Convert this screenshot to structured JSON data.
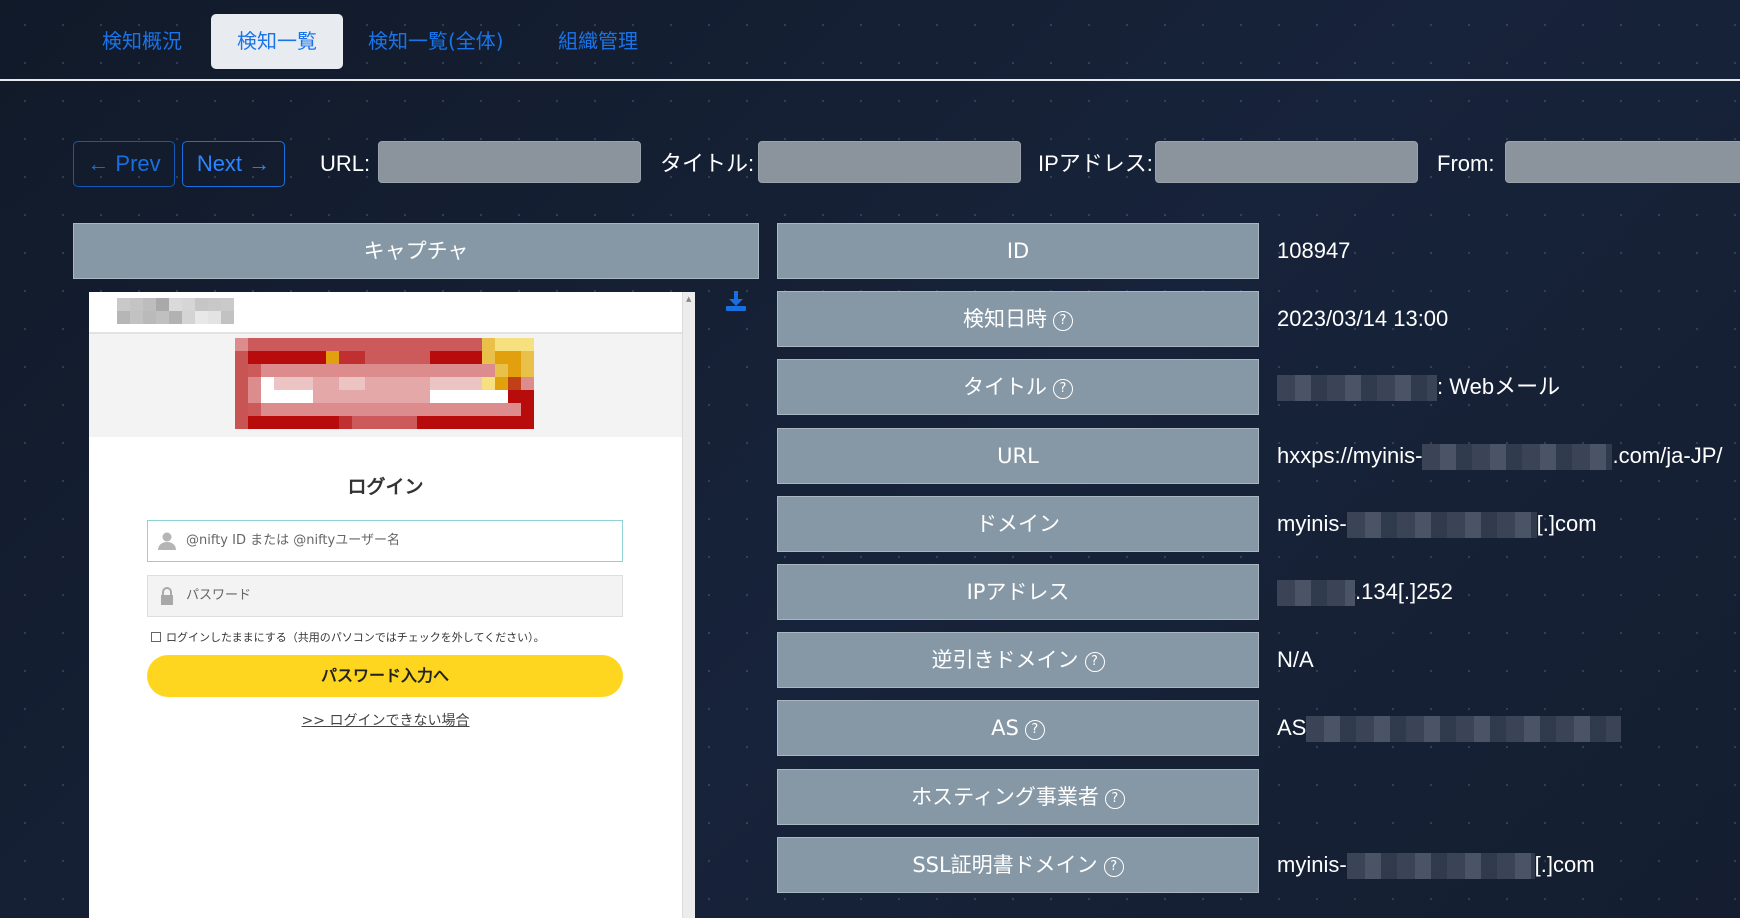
{
  "nav": {
    "tabs": [
      {
        "label": "検知概況",
        "active": false
      },
      {
        "label": "検知一覧",
        "active": true
      },
      {
        "label": "検知一覧(全体)",
        "active": false
      },
      {
        "label": "組織管理",
        "active": false
      }
    ]
  },
  "filters": {
    "prev_label": "← Prev",
    "next_label": "Next →",
    "url_label": "URL:",
    "url_value": "",
    "title_label": "タイトル:",
    "title_value": "",
    "ip_label": "IPアドレス:",
    "ip_value": "",
    "from_label": "From:",
    "from_value": ""
  },
  "capture": {
    "header": "キャプチャ",
    "download_icon": "download-icon",
    "screenshot": {
      "login_title": "ログイン",
      "user_placeholder": "@nifty ID または @niftyユーザー名",
      "password_placeholder": "パスワード",
      "keep_logged_in": "ログインしたままにする（共用のパソコンではチェックを外してください）。",
      "submit_label": "パスワード入力へ",
      "cant_login_link": ">> ログインできない場合"
    }
  },
  "details": {
    "rows": [
      {
        "label": "ID",
        "help": false,
        "value": "108947"
      },
      {
        "label": "検知日時",
        "help": true,
        "value": "2023/03/14 13:00"
      },
      {
        "label": "タイトル",
        "help": true,
        "value_suffix": ": Webメール",
        "redacted": true
      },
      {
        "label": "URL",
        "help": false,
        "value_prefix": "hxxps://myinis-",
        "value_suffix": ".com/ja-JP/",
        "redacted": true
      },
      {
        "label": "ドメイン",
        "help": false,
        "value_prefix": "myinis-",
        "value_suffix": "[.]com",
        "redacted": true
      },
      {
        "label": "IPアドレス",
        "help": false,
        "value_suffix": ".134[.]252",
        "redacted": true
      },
      {
        "label": "逆引きドメイン",
        "help": true,
        "value": "N/A"
      },
      {
        "label": "AS",
        "help": true,
        "value_prefix": "AS",
        "redacted": true
      },
      {
        "label": "ホスティング事業者",
        "help": true,
        "value": ""
      },
      {
        "label": "SSL証明書ドメイン",
        "help": true,
        "value_prefix": "myinis-",
        "value_suffix": "[.]com",
        "redacted": true
      }
    ],
    "help_glyph": "?"
  }
}
